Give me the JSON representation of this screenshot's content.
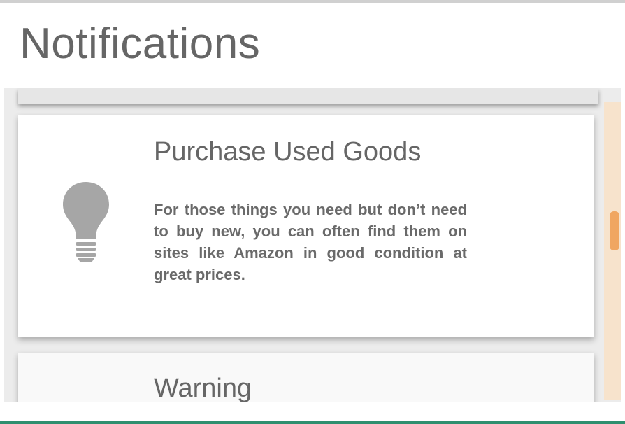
{
  "page": {
    "title": "Notifications"
  },
  "notifications": [
    {
      "title": "Purchase Used Goods",
      "body": "For those things you need but don’t need to buy new, you can often find them on sites like Amazon in good condition at great prices.",
      "icon": "lightbulb-icon"
    },
    {
      "title": "Warning",
      "body": "",
      "icon": ""
    }
  ],
  "colors": {
    "text": "#666666",
    "card_background": "#ffffff",
    "panel_background": "#ececec",
    "scrollbar_track": "#f7e3cc",
    "scrollbar_thumb": "#f0a661",
    "bottom_accent": "#2f8f6f"
  }
}
